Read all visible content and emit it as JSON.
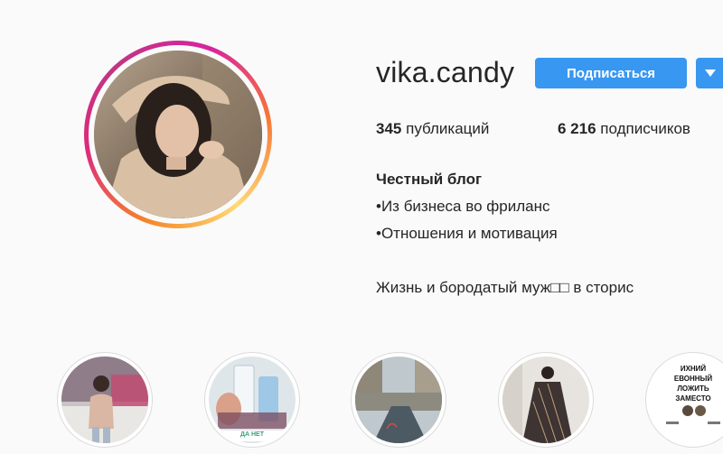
{
  "profile": {
    "username": "vika.candy",
    "follow_label": "Подписаться",
    "stats": {
      "posts_count": "345",
      "posts_label": "публикаций",
      "followers_count": "6 216",
      "followers_label": "подписчиков"
    },
    "bio": {
      "name": "Честный блог",
      "line1": "•Из бизнеса во фриланс",
      "line2": "•Отношения и мотивация",
      "line3": "Жизнь и бородатый муж□□ в сторис"
    }
  },
  "highlights": [
    {
      "overlay": ""
    },
    {
      "overlay": "ДА   НЕТ"
    },
    {
      "overlay": ""
    },
    {
      "overlay": ""
    },
    {
      "overlay": "ИХНИЙ ЕВОННЫЙ ЛОЖИТЬ ЗАМЕСТО"
    }
  ],
  "colors": {
    "accent": "#3897f0",
    "text": "#262626",
    "background": "#fafafa"
  }
}
